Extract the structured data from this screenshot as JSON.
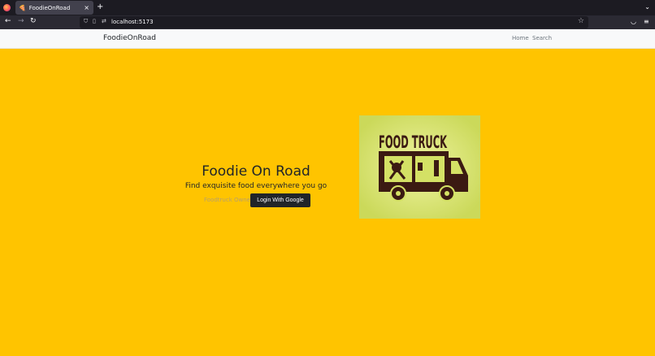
{
  "browser": {
    "tab_title": "FoodieOnRoad",
    "tab_close": "×",
    "new_tab": "+",
    "url": "localhost:5173"
  },
  "site": {
    "brand": "FoodieOnRoad",
    "nav": [
      "Home",
      "Search"
    ]
  },
  "hero": {
    "title": "Foodie On Road",
    "subtitle": "Find exquisite food everywhere you go",
    "owner_label": "Foodtruck Owner?",
    "login_label": "Login With Google",
    "logo_text": "FOOD TRUCK"
  },
  "colors": {
    "background": "#ffc400",
    "logo_bg": "#d4e165",
    "truck": "#3b1a12"
  }
}
